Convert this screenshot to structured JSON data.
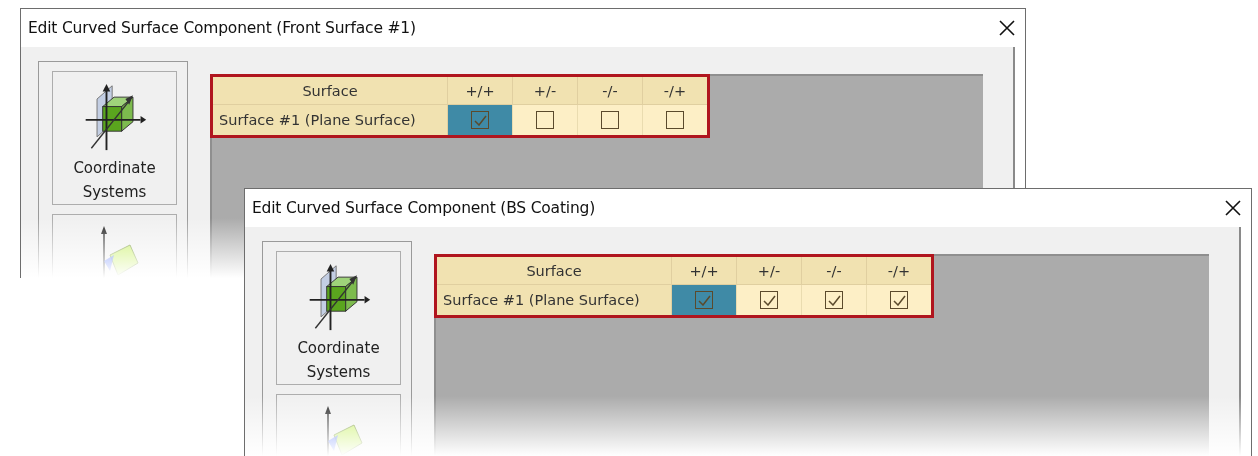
{
  "windows": [
    {
      "title": "Edit Curved Surface Component (Front Surface #1)",
      "tools": [
        {
          "kind": "coordinate",
          "label": "Coordinate Systems"
        },
        {
          "kind": "plane"
        }
      ],
      "table": {
        "columns": [
          "Surface",
          "+/+",
          "+/-",
          "-/-",
          "-/+"
        ],
        "rows": [
          {
            "name": "Surface #1 (Plane Surface)",
            "cells": [
              {
                "checked": true,
                "selected": true
              },
              {
                "checked": false,
                "selected": false
              },
              {
                "checked": false,
                "selected": false
              },
              {
                "checked": false,
                "selected": false
              }
            ]
          }
        ]
      }
    },
    {
      "title": "Edit Curved Surface Component (BS Coating)",
      "tools": [
        {
          "kind": "coordinate",
          "label": "Coordinate Systems"
        },
        {
          "kind": "plane"
        }
      ],
      "table": {
        "columns": [
          "Surface",
          "+/+",
          "+/-",
          "-/-",
          "-/+"
        ],
        "rows": [
          {
            "name": "Surface #1 (Plane Surface)",
            "cells": [
              {
                "checked": true,
                "selected": true
              },
              {
                "checked": true,
                "selected": false
              },
              {
                "checked": true,
                "selected": false
              },
              {
                "checked": true,
                "selected": false
              }
            ]
          }
        ]
      }
    }
  ]
}
